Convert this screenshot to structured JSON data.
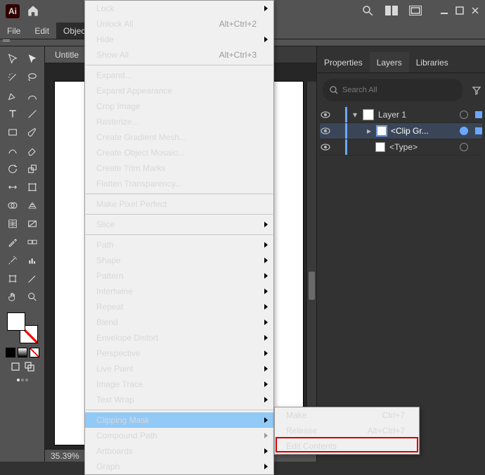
{
  "titlebar": {
    "logo_text": "Ai"
  },
  "menubar": {
    "file": "File",
    "edit": "Edit",
    "object": "Object"
  },
  "doc": {
    "tab_title": "Untitle",
    "zoom": "35.39%"
  },
  "panel": {
    "tabs": {
      "properties": "Properties",
      "layers": "Layers",
      "libraries": "Libraries"
    },
    "search_placeholder": "Search All"
  },
  "layers": {
    "row0": {
      "name": "Layer 1"
    },
    "row1": {
      "name": "<Clip Gr..."
    },
    "row2": {
      "name": "<Type>"
    }
  },
  "object_menu": {
    "lock": "Lock",
    "unlock_all": "Unlock All",
    "unlock_all_sc": "Alt+Ctrl+2",
    "hide": "Hide",
    "show_all": "Show All",
    "show_all_sc": "Alt+Ctrl+3",
    "expand": "Expand...",
    "expand_appearance": "Expand Appearance",
    "crop_image": "Crop Image",
    "rasterize": "Rasterize...",
    "create_gradient_mesh": "Create Gradient Mesh...",
    "create_object_mosaic": "Create Object Mosaic...",
    "create_trim_marks": "Create Trim Marks",
    "flatten_transparency": "Flatten Transparency...",
    "make_pixel_perfect": "Make Pixel Perfect",
    "slice": "Slice",
    "path": "Path",
    "shape": "Shape",
    "pattern": "Pattern",
    "intertwine": "Intertwine",
    "repeat": "Repeat",
    "blend": "Blend",
    "envelope_distort": "Envelope Distort",
    "perspective": "Perspective",
    "live_paint": "Live Paint",
    "image_trace": "Image Trace",
    "text_wrap": "Text Wrap",
    "clipping_mask": "Clipping Mask",
    "compound_path": "Compound Path",
    "artboards": "Artboards",
    "graph": "Graph"
  },
  "clipping_submenu": {
    "make": "Make",
    "make_sc": "Ctrl+7",
    "release": "Release",
    "release_sc": "Alt+Ctrl+7",
    "edit_contents": "Edit Contents"
  }
}
